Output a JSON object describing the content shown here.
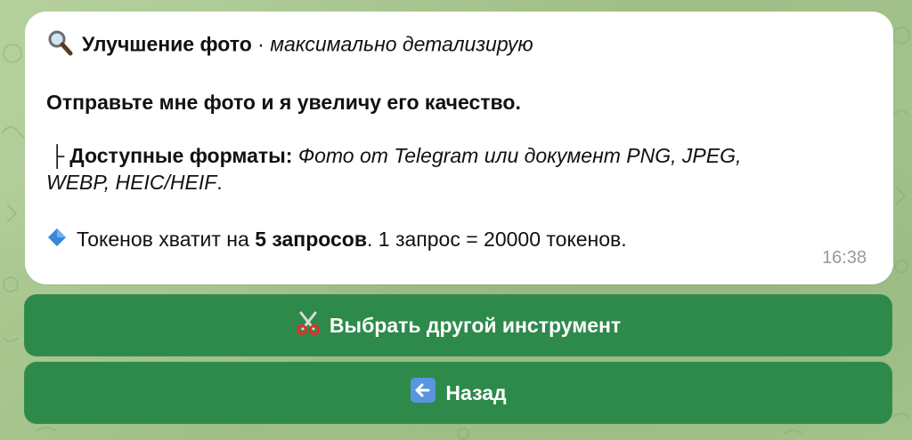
{
  "message": {
    "header_title": "Улучшение фото",
    "header_separator": " · ",
    "header_mode": "максимально детализирую",
    "prompt": "Отправьте мне фото и я увеличу его качество.",
    "tree_char": "├",
    "formats_label": "Доступные форматы:",
    "formats_value_line1": "Фото от Telegram или документ PNG, JPEG,",
    "formats_value_line2": "WEBP, HEIC/HEIF",
    "formats_period": ".",
    "tokens_prefix": "Токенов хватит на ",
    "tokens_bold": "5 запросов",
    "tokens_suffix": ". 1 запрос = 20000 токенов.",
    "time": "16:38",
    "icons": {
      "header": "magnifying-glass-icon",
      "tokens": "blue-diamond-icon"
    }
  },
  "keyboard": {
    "buttons": [
      {
        "label": "Выбрать другой инструмент",
        "icon": "scissors-icon"
      },
      {
        "label": "Назад",
        "icon": "left-arrow-icon"
      }
    ]
  },
  "colors": {
    "button_bg": "#2e8a4b",
    "bubble_bg": "#ffffff",
    "time_text": "#9a9a9a",
    "wallpaper": "#a9c58f",
    "diamond": "#3a86d8"
  }
}
